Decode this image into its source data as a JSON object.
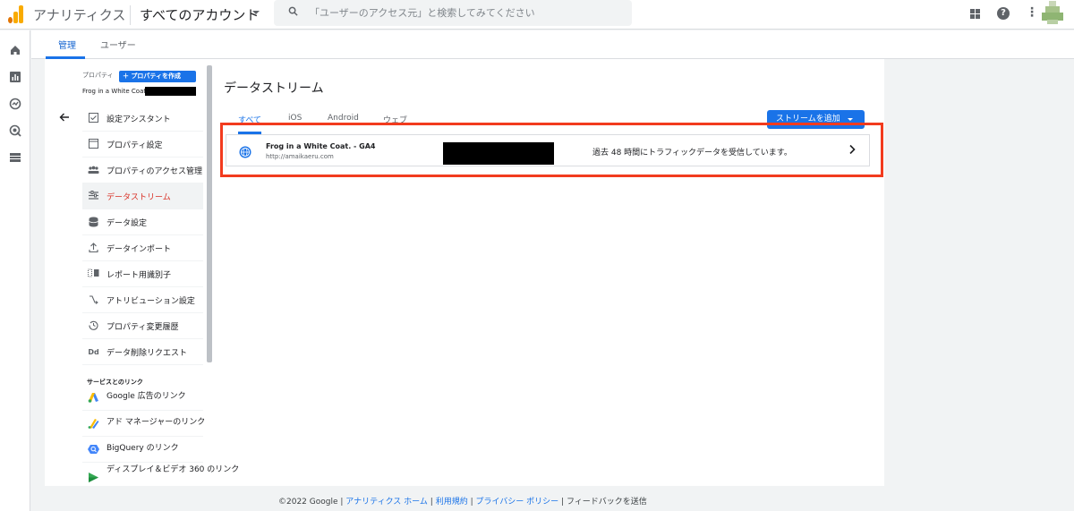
{
  "header": {
    "app_title": "アナリティクス",
    "account_title": "すべてのアカウント",
    "search_placeholder": "「ユーザーのアクセス元」と検索してみてください"
  },
  "admin_tabs": [
    {
      "label": "管理",
      "active": true
    },
    {
      "label": "ユーザー",
      "active": false
    }
  ],
  "property": {
    "label": "プロパティ",
    "create_button": "＋ プロパティを作成",
    "name": "Frog in a White Coat. -"
  },
  "menu": [
    {
      "label": "設定アシスタント",
      "icon": "checkbox-icon",
      "active": false
    },
    {
      "label": "プロパティ設定",
      "icon": "window-icon",
      "active": false
    },
    {
      "label": "プロパティのアクセス管理",
      "icon": "people-icon",
      "active": false
    },
    {
      "label": "データストリーム",
      "icon": "stream-icon",
      "active": true
    },
    {
      "label": "データ設定",
      "icon": "database-icon",
      "active": false
    },
    {
      "label": "データインポート",
      "icon": "upload-icon",
      "active": false
    },
    {
      "label": "レポート用識別子",
      "icon": "identifier-icon",
      "active": false
    },
    {
      "label": "アトリビューション設定",
      "icon": "attribution-icon",
      "active": false
    },
    {
      "label": "プロパティ変更履歴",
      "icon": "history-icon",
      "active": false
    },
    {
      "label": "データ削除リクエスト",
      "icon": "dd-icon",
      "active": false
    }
  ],
  "links_section": {
    "heading": "サービスとのリンク",
    "items": [
      {
        "label": "Google 広告のリンク",
        "icon": "google-ads-icon"
      },
      {
        "label": "アド マネージャーのリンク",
        "icon": "ad-manager-icon"
      },
      {
        "label": "BigQuery のリンク",
        "icon": "bigquery-icon"
      },
      {
        "label": "ディスプレイ＆ビデオ 360 のリンク",
        "icon": "dv360-icon"
      }
    ]
  },
  "streams": {
    "title": "データストリーム",
    "tabs": [
      {
        "label": "すべて",
        "active": true
      },
      {
        "label": "iOS",
        "active": false
      },
      {
        "label": "Android",
        "active": false
      },
      {
        "label": "ウェブ",
        "active": false
      }
    ],
    "add_button": "ストリームを追加",
    "rows": [
      {
        "name": "Frog in a White Coat. - GA4",
        "url": "http://amaikaeru.com",
        "status": "過去 48 時間にトラフィックデータを受信しています。"
      }
    ]
  },
  "footer": {
    "copyright": "©2022 Google",
    "links": [
      "アナリティクス ホーム",
      "利用規約",
      "プライバシー ポリシー"
    ],
    "feedback": "フィードバックを送信"
  },
  "colors": {
    "accent": "#1a73e8",
    "highlight": "#f23b1e",
    "active_menu": "#d93025"
  }
}
